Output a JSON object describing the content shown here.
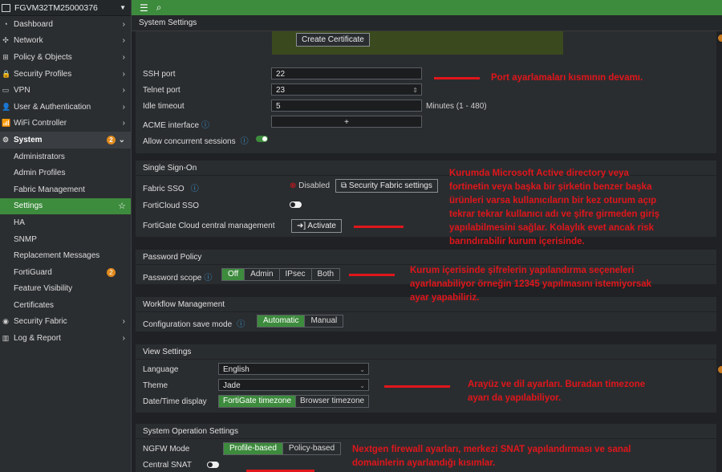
{
  "device_name": "FGVM32TM25000376",
  "topbar": {
    "menu_icon": "☰",
    "search_icon": "⌕"
  },
  "page_title": "System Settings",
  "sidebar": {
    "items": [
      {
        "label": "Dashboard",
        "icon": "◔"
      },
      {
        "label": "Network",
        "icon": "✣"
      },
      {
        "label": "Policy & Objects",
        "icon": "⊞"
      },
      {
        "label": "Security Profiles",
        "icon": "🔒"
      },
      {
        "label": "VPN",
        "icon": "▭"
      },
      {
        "label": "User & Authentication",
        "icon": "👤"
      },
      {
        "label": "WiFi Controller",
        "icon": "📶"
      },
      {
        "label": "System",
        "icon": "⚙",
        "badge": "2"
      }
    ],
    "system_sub": [
      {
        "label": "Administrators"
      },
      {
        "label": "Admin Profiles"
      },
      {
        "label": "Fabric Management"
      },
      {
        "label": "Settings"
      },
      {
        "label": "HA"
      },
      {
        "label": "SNMP"
      },
      {
        "label": "Replacement Messages"
      },
      {
        "label": "FortiGuard",
        "badge": "2"
      },
      {
        "label": "Feature Visibility"
      },
      {
        "label": "Certificates"
      }
    ],
    "bottom": [
      {
        "label": "Security Fabric",
        "icon": "◉"
      },
      {
        "label": "Log & Report",
        "icon": "▥"
      }
    ]
  },
  "cert": {
    "button": "Create Certificate"
  },
  "admin": {
    "ssh_port_label": "SSH port",
    "ssh_port": "22",
    "telnet_port_label": "Telnet port",
    "telnet_port": "23",
    "idle_timeout_label": "Idle timeout",
    "idle_timeout": "5",
    "idle_timeout_unit": "Minutes (1 - 480)",
    "acme_label": "ACME interface",
    "acme_value": "+",
    "concurrent_label": "Allow concurrent sessions"
  },
  "sso": {
    "heading": "Single Sign-On",
    "fabric_sso_label": "Fabric SSO",
    "fabric_sso_status": "Disabled",
    "fabric_settings_button": "Security Fabric settings",
    "forticloud_sso_label": "FortiCloud SSO",
    "cloud_mgmt_label": "FortiGate Cloud central management",
    "activate_button": "Activate"
  },
  "password": {
    "heading": "Password Policy",
    "scope_label": "Password scope",
    "options": [
      "Off",
      "Admin",
      "IPsec",
      "Both"
    ],
    "selected": "Off"
  },
  "workflow": {
    "heading": "Workflow Management",
    "save_mode_label": "Configuration save mode",
    "options": [
      "Automatic",
      "Manual"
    ],
    "selected": "Automatic"
  },
  "view": {
    "heading": "View Settings",
    "language_label": "Language",
    "language": "English",
    "theme_label": "Theme",
    "theme": "Jade",
    "datetime_label": "Date/Time display",
    "datetime_options": [
      "FortiGate timezone",
      "Browser timezone"
    ],
    "datetime_selected": "FortiGate timezone"
  },
  "sysop": {
    "heading": "System Operation Settings",
    "ngfw_label": "NGFW Mode",
    "ngfw_options": [
      "Profile-based",
      "Policy-based"
    ],
    "ngfw_selected": "Profile-based",
    "central_snat_label": "Central SNAT"
  },
  "annotations": {
    "ports": "Port ayarlamaları kısmının devamı.",
    "sso": "Kurumda Microsoft Active directory veya\nfortinetin veya başka bir şirketin benzer başka\nürünleri varsa kullanıcıların bir kez oturum açıp\ntekrar tekrar kullanıcı adı ve şifre girmeden giriş\nyapılabilmesini sağlar. Kolaylık evet ancak risk\nbarındırabilir kurum içerisinde.",
    "password": "Kurum içerisinde şifrelerin yapılandırma seçeneleri\nayarlanabiliyor örneğin 12345 yapılmasını istemiyorsak\nayar yapabiliriz.",
    "view": "Arayüz ve dil ayarları. Buradan timezone\nayarı da yapılabiliyor.",
    "sysop": "Nextgen firewall ayarları, merkezi SNAT yapılandırması ve sanal\ndomainlerin ayarlandığı kısımlar."
  },
  "colors": {
    "accent": "#3d8b3d",
    "annotation": "#e0161b",
    "badge": "#e08a1e",
    "info": "#3a9ad9"
  }
}
